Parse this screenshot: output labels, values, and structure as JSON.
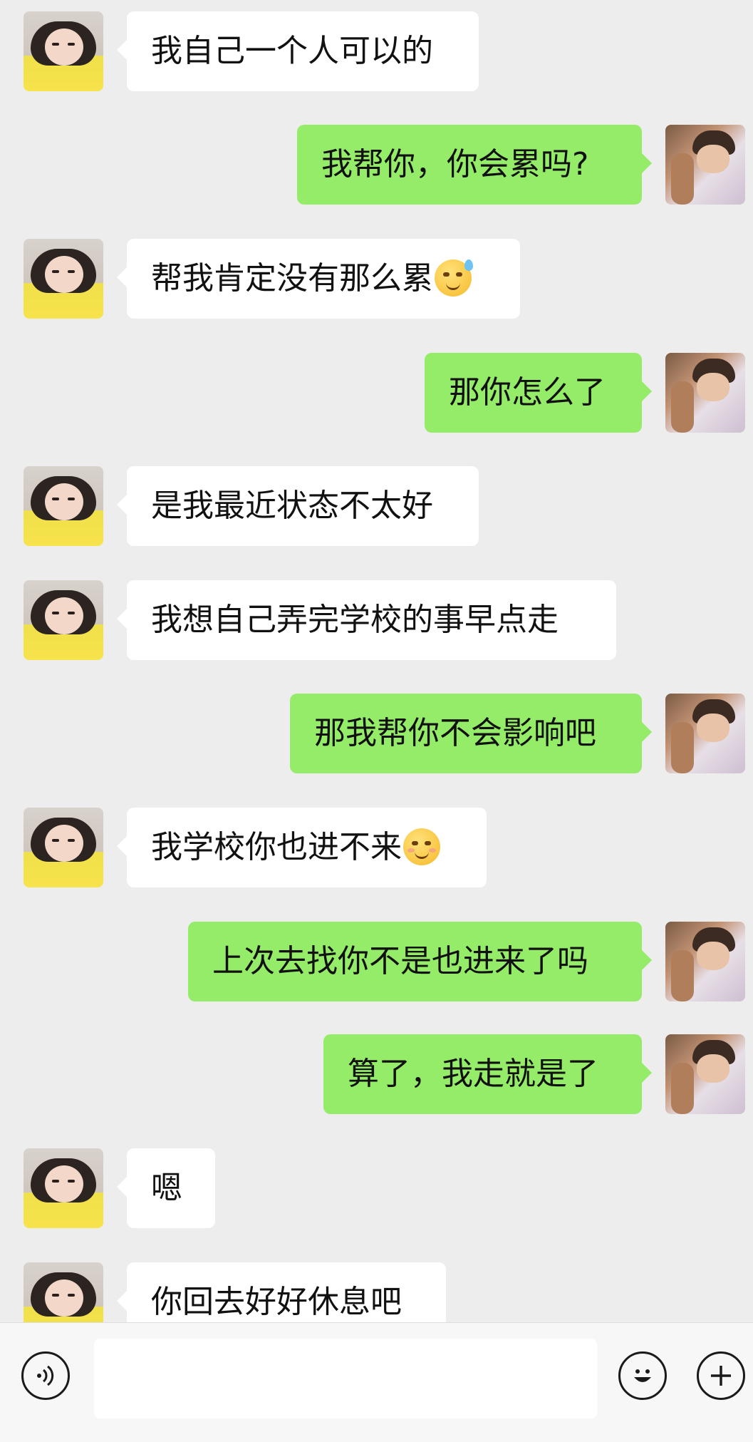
{
  "messages": [
    {
      "side": "in",
      "text": "我自己一个人可以的",
      "emoji": null
    },
    {
      "side": "out",
      "text": "我帮你，你会累吗?",
      "emoji": null
    },
    {
      "side": "in",
      "text": "帮我肯定没有那么累",
      "emoji": "sweat-smile"
    },
    {
      "side": "out",
      "text": "那你怎么了",
      "emoji": null
    },
    {
      "side": "in",
      "text": "是我最近状态不太好",
      "emoji": null
    },
    {
      "side": "in",
      "text": "我想自己弄完学校的事早点走",
      "emoji": null
    },
    {
      "side": "out",
      "text": "那我帮你不会影响吧",
      "emoji": null
    },
    {
      "side": "in",
      "text": "我学校你也进不来",
      "emoji": "blush-smile"
    },
    {
      "side": "out",
      "text": "上次去找你不是也进来了吗",
      "emoji": null
    },
    {
      "side": "out",
      "text": "算了，我走就是了",
      "emoji": null
    },
    {
      "side": "in",
      "text": "嗯",
      "emoji": null
    },
    {
      "side": "in",
      "text": "你回去好好休息吧",
      "emoji": null
    }
  ],
  "input": {
    "value": "",
    "voice_icon": "voice-icon",
    "emoji_icon": "emoji-icon",
    "plus_icon": "plus-icon"
  },
  "colors": {
    "background": "#ededed",
    "incoming_bubble": "#ffffff",
    "outgoing_bubble": "#95ec69"
  }
}
